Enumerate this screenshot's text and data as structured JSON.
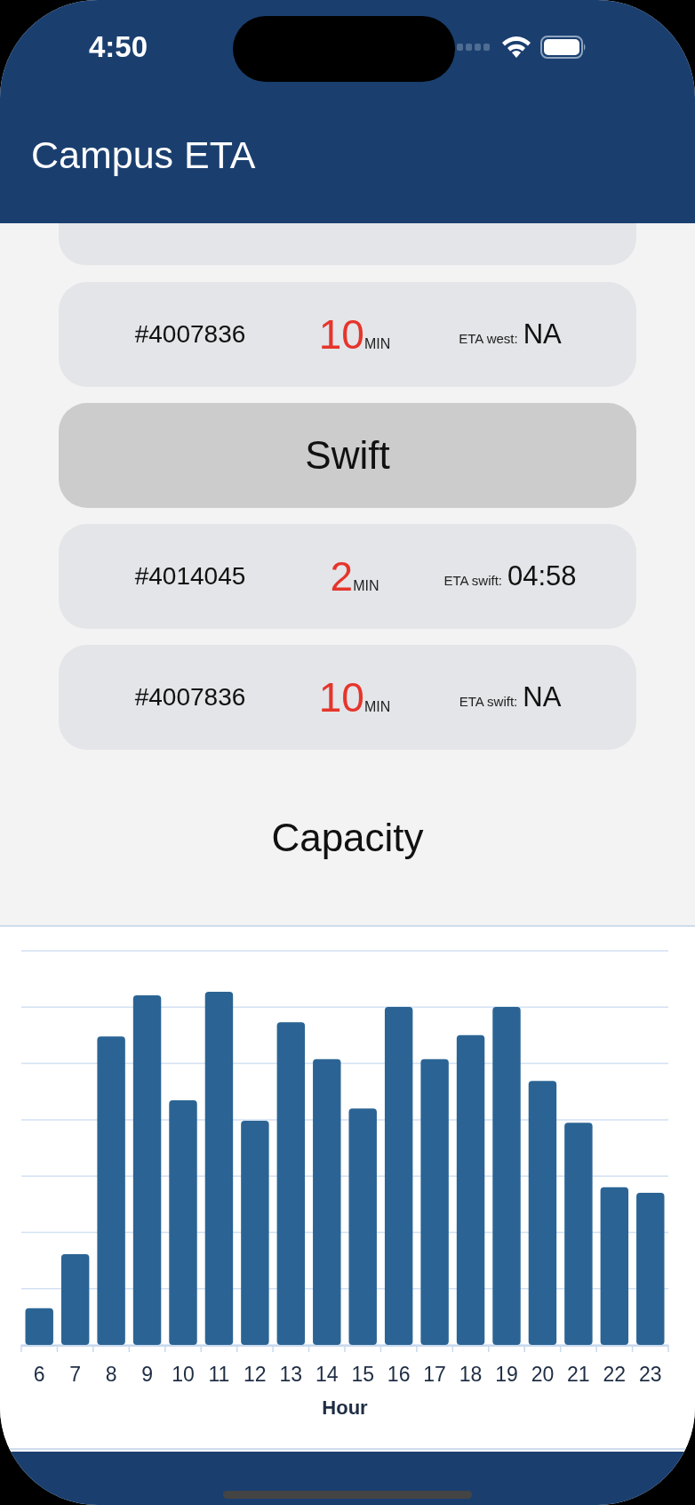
{
  "status_bar": {
    "time": "4:50"
  },
  "nav_bar": {
    "title": "Campus ETA"
  },
  "list": [
    {
      "kind": "bus",
      "id": "#4007836",
      "minutes": "10",
      "unit": "MIN",
      "eta_label": "ETA west:",
      "eta": "NA"
    },
    {
      "kind": "route",
      "title": "Swift"
    },
    {
      "kind": "bus",
      "id": "#4014045",
      "minutes": "2",
      "unit": "MIN",
      "eta_label": "ETA swift:",
      "eta": "04:58"
    },
    {
      "kind": "bus",
      "id": "#4007836",
      "minutes": "10",
      "unit": "MIN",
      "eta_label": "ETA swift:",
      "eta": "NA"
    }
  ],
  "capacity": {
    "title": "Capacity",
    "hours": [
      "6",
      "7",
      "8",
      "9",
      "10",
      "11",
      "12",
      "13",
      "14",
      "15",
      "16",
      "17",
      "18",
      "19",
      "20",
      "21",
      "22",
      "23"
    ],
    "xlabel": "Hour"
  }
}
